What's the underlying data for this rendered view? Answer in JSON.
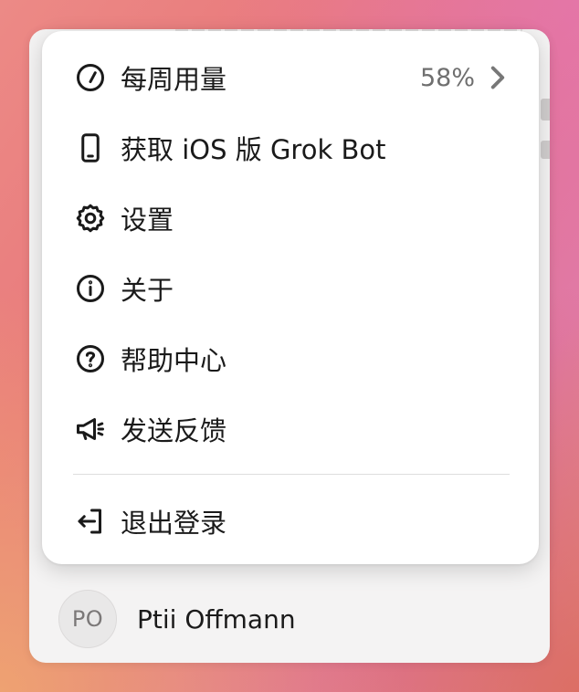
{
  "user": {
    "initials": "PO",
    "name": "Ptii Offmann"
  },
  "menu": {
    "items": [
      {
        "label": "每周用量",
        "value": "58%",
        "icon": "gauge-icon"
      },
      {
        "label": "获取 iOS 版 Grok Bot",
        "icon": "phone-icon"
      },
      {
        "label": "设置",
        "icon": "gear-icon"
      },
      {
        "label": "关于",
        "icon": "info-icon"
      },
      {
        "label": "帮助中心",
        "icon": "help-icon"
      },
      {
        "label": "发送反馈",
        "icon": "megaphone-icon"
      }
    ],
    "logout": {
      "label": "退出登录",
      "icon": "logout-icon"
    }
  },
  "colors": {
    "menu_bg": "#ffffff",
    "text": "#1a1a1a",
    "muted_text": "#6f6f6f",
    "divider": "#dedede"
  }
}
